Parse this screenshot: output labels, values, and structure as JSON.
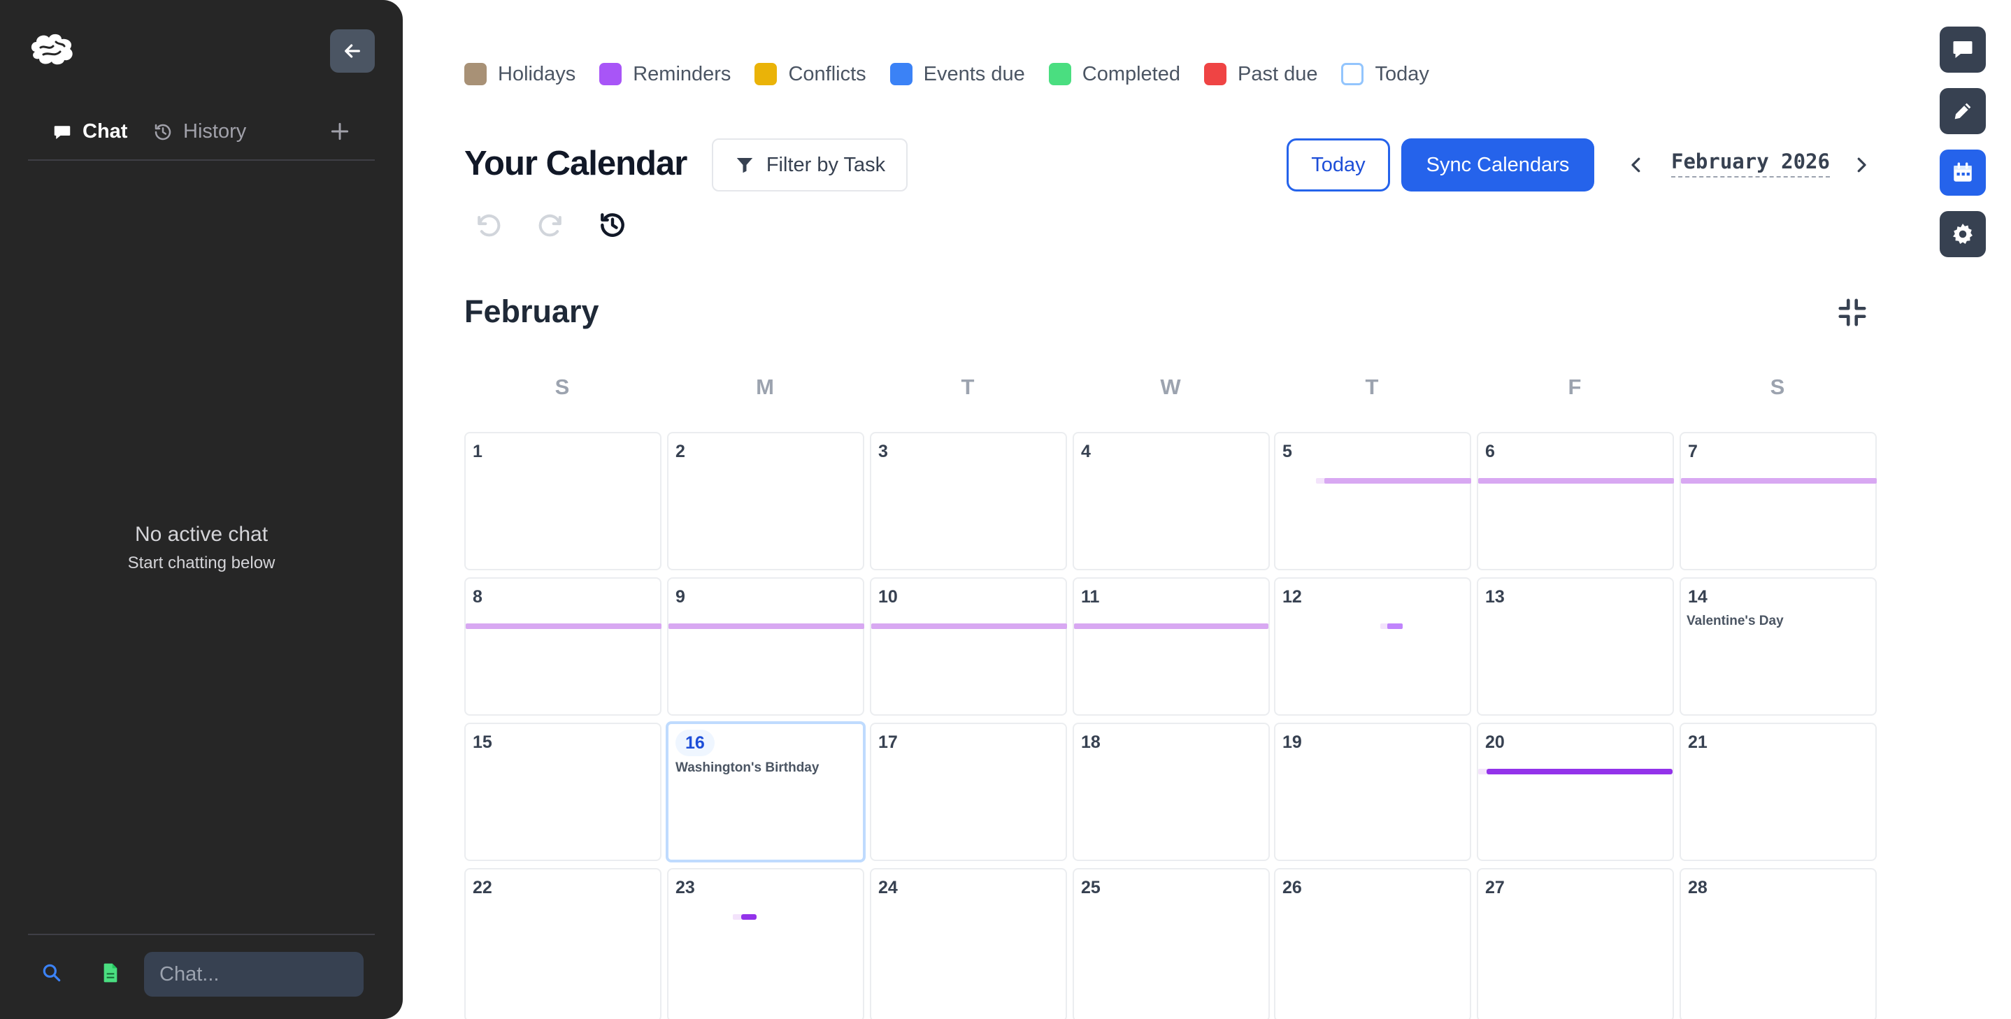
{
  "sidebar": {
    "tabs": {
      "chat": "Chat",
      "history": "History"
    },
    "empty_title": "No active chat",
    "empty_subtitle": "Start chatting below",
    "chat_placeholder": "Chat..."
  },
  "legend": [
    {
      "label": "Holidays",
      "color": "#a89176"
    },
    {
      "label": "Reminders",
      "color": "#a855f7"
    },
    {
      "label": "Conflicts",
      "color": "#eab308"
    },
    {
      "label": "Events due",
      "color": "#3b82f6"
    },
    {
      "label": "Completed",
      "color": "#4ade80"
    },
    {
      "label": "Past due",
      "color": "#ef4444"
    },
    {
      "label": "Today",
      "color": "#ffffff",
      "outline": "#93c5fd"
    }
  ],
  "header": {
    "title": "Your Calendar",
    "filter_label": "Filter by Task",
    "today_label": "Today",
    "sync_label": "Sync Calendars",
    "current_month": "February 2026"
  },
  "calendar": {
    "month_title": "February",
    "weekdays": [
      "S",
      "M",
      "T",
      "W",
      "T",
      "F",
      "S"
    ],
    "days": [
      "1",
      "2",
      "3",
      "4",
      "5",
      "6",
      "7",
      "8",
      "9",
      "10",
      "11",
      "12",
      "13",
      "14",
      "15",
      "16",
      "17",
      "18",
      "19",
      "20",
      "21",
      "22",
      "23",
      "24",
      "25",
      "26",
      "27",
      "28"
    ],
    "today": "16",
    "holidays": {
      "valentines": "Valentine's Day",
      "washington": "Washington's Birthday"
    }
  },
  "colors": {
    "accent": "#2563eb",
    "sidebar_bg": "#262626",
    "reminder_bar": "#d8a8f2",
    "reminder_bar_dark": "#9333ea"
  }
}
